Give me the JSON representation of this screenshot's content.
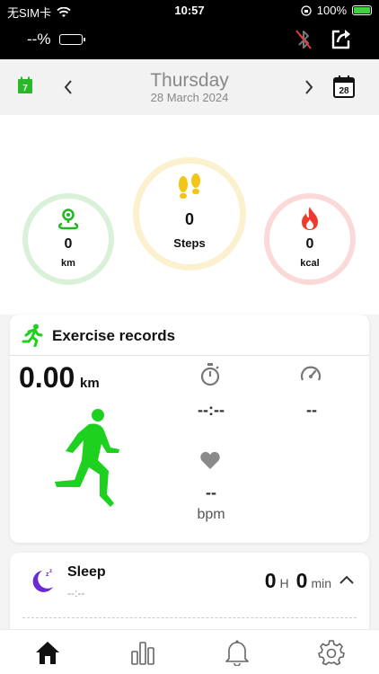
{
  "status_bar": {
    "carrier": "无SIM卡",
    "time": "10:57",
    "battery_percent": "100%",
    "battery_level": 1.0
  },
  "device_bar": {
    "battery_text": "--%"
  },
  "date_header": {
    "day": "Thursday",
    "date": "28 March 2024",
    "left_calendar_day": "7",
    "right_calendar_day": "28"
  },
  "metrics": {
    "distance": {
      "value": "0",
      "unit": "km"
    },
    "steps": {
      "value": "0",
      "unit": "Steps"
    },
    "calories": {
      "value": "0",
      "unit": "kcal"
    }
  },
  "exercise": {
    "title": "Exercise records",
    "distance_value": "0.00",
    "distance_unit": "km",
    "duration": "--:--",
    "speed": "--",
    "heart_rate": "--",
    "heart_rate_unit": "bpm"
  },
  "sleep": {
    "title": "Sleep",
    "time": "--:--",
    "hours": "0",
    "hours_unit": "H",
    "minutes": "0",
    "minutes_unit": "min"
  },
  "colors": {
    "accent_green": "#1fd11f",
    "steps_yellow": "#f3c516",
    "calories_red": "#ef3b2d",
    "sleep_purple": "#6a2bd6"
  },
  "icons": [
    "wifi-icon",
    "bluetooth-off-icon",
    "share-icon",
    "calendar-icon",
    "route-pin-icon",
    "footprints-icon",
    "flame-icon",
    "running-icon",
    "stopwatch-icon",
    "speedometer-icon",
    "heart-icon",
    "moon-icon",
    "chevron-up-icon",
    "home-icon",
    "bar-chart-icon",
    "bell-icon",
    "gear-icon"
  ]
}
